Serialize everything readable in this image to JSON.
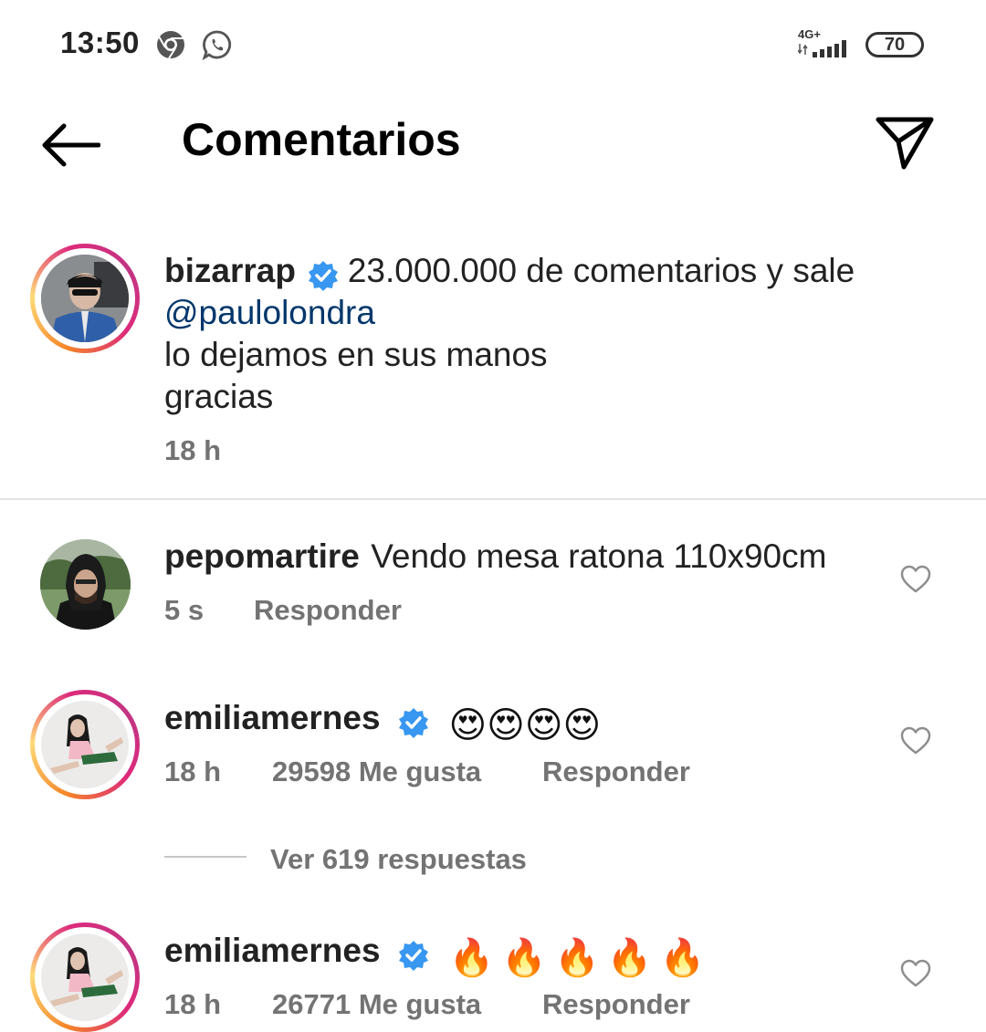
{
  "status_bar": {
    "time": "13:50",
    "network": "4G+",
    "battery": "70",
    "icons": [
      "chrome-icon",
      "whatsapp-icon",
      "signal-icon"
    ]
  },
  "header": {
    "title": "Comentarios",
    "back_icon": "arrow-left-icon",
    "share_icon": "send-icon"
  },
  "caption": {
    "username": "bizarrap",
    "verified": true,
    "text_line1": "23.000.000 de comentarios y sale",
    "mention": "@paulolondra",
    "text_line2": "lo dejamos en sus manos",
    "text_line3": "gracias",
    "time": "18 h"
  },
  "comments": [
    {
      "username": "pepomartire",
      "verified": false,
      "text": "Vendo mesa ratona 110x90cm",
      "time": "5 s",
      "reply_label": "Responder"
    },
    {
      "username": "emiliamernes",
      "verified": true,
      "text": "😍😍😍😍",
      "time": "18 h",
      "likes": "29598 Me gusta",
      "reply_label": "Responder",
      "view_replies": "Ver 619 respuestas"
    },
    {
      "username": "emiliamernes",
      "verified": true,
      "text": "🔥🔥🔥🔥🔥",
      "time": "18 h",
      "likes": "26771 Me gusta",
      "reply_label": "Responder"
    }
  ],
  "colors": {
    "mention": "#00376b",
    "verified": "#3897f0",
    "meta": "#737373"
  }
}
